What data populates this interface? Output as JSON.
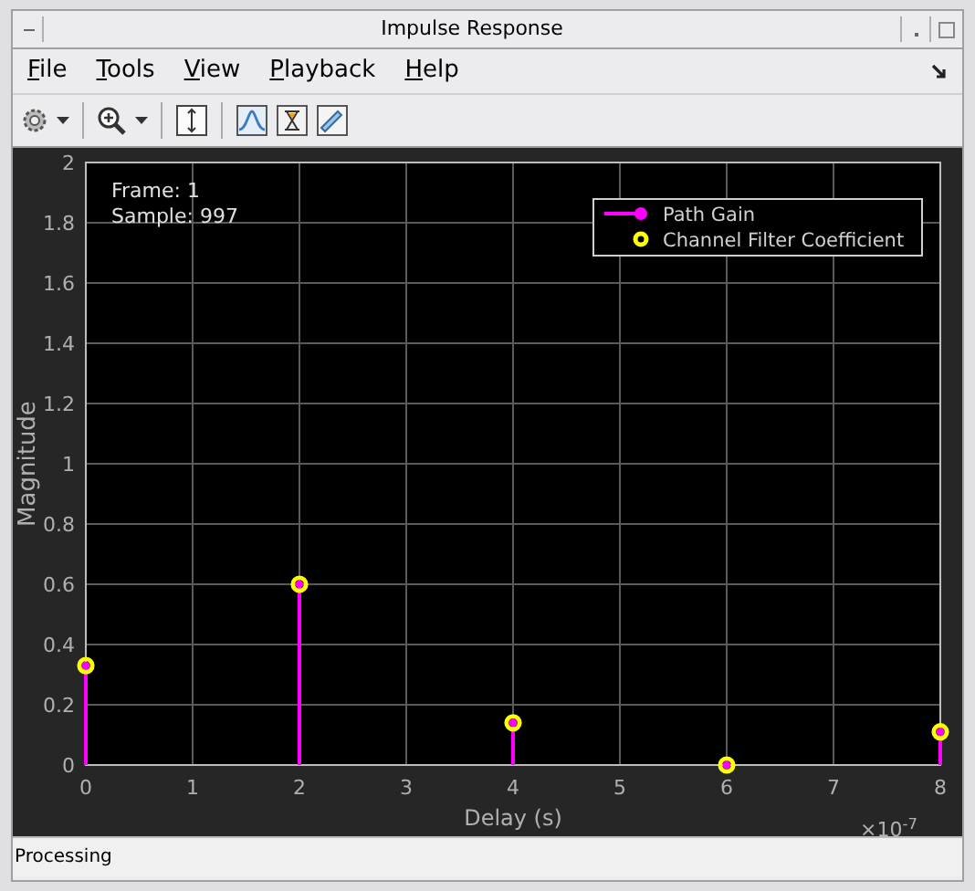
{
  "window": {
    "title": "Impulse Response"
  },
  "menu": [
    "File",
    "Tools",
    "View",
    "Playback",
    "Help"
  ],
  "plot": {
    "info_lines": [
      "Frame: 1",
      "Sample: 997"
    ],
    "chart_data": {
      "type": "scatter",
      "xlabel": "Delay (s)",
      "ylabel": "Magnitude",
      "x": [
        0,
        2,
        4,
        6,
        8
      ],
      "series": [
        {
          "name": "Path Gain",
          "type": "bar",
          "color": "#ff00ff",
          "values": [
            0.33,
            0.6,
            0.14,
            0,
            0.11
          ]
        },
        {
          "name": "Channel Filter Coefficient",
          "color": "#ffff00",
          "values": [
            0.33,
            0.6,
            0.14,
            0,
            0.11
          ]
        }
      ],
      "grid": true,
      "legend": true,
      "xlim": [
        0,
        8
      ],
      "ylim": [
        0,
        2
      ],
      "xticks": [
        0,
        1,
        2,
        3,
        4,
        5,
        6,
        7,
        8
      ],
      "yticks": [
        0,
        0.2,
        0.4,
        0.6,
        0.8,
        1,
        1.2,
        1.4,
        1.6,
        1.8,
        2
      ],
      "annotations": [
        {
          "text": "×10$^{-7}$"
        }
      ]
    }
  },
  "status_bar": {
    "text": "Processing"
  }
}
